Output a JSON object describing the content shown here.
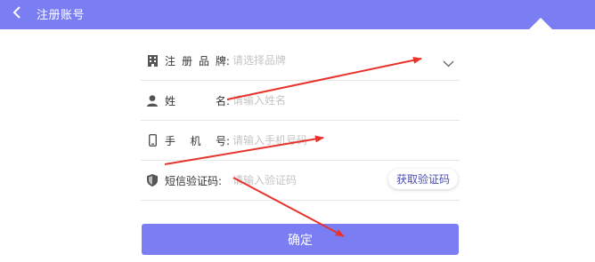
{
  "header": {
    "title": "注册账号",
    "back_icon": "chevron-left-icon",
    "background": "#7b7ef2"
  },
  "form": {
    "brand": {
      "label_chars": [
        "注",
        "册",
        "品",
        "牌"
      ],
      "colon": ":",
      "placeholder": "请选择品牌",
      "icon": "building-icon",
      "dropdown_icon": "chevron-down-icon"
    },
    "name": {
      "label_chars": [
        "姓",
        "名"
      ],
      "colon": ":",
      "placeholder": "请输入姓名",
      "icon": "user-icon"
    },
    "phone": {
      "label_chars": [
        "手",
        "机",
        "号"
      ],
      "colon": ":",
      "placeholder": "请输入手机号码",
      "icon": "phone-icon"
    },
    "code": {
      "label": "短信验证码",
      "colon": ":",
      "placeholder": "请输入验证码",
      "icon": "shield-icon",
      "button_label": "获取验证码"
    }
  },
  "submit": {
    "label": "确定"
  },
  "colors": {
    "accent": "#7b7ef2",
    "annotation_arrow": "#e8332c"
  }
}
